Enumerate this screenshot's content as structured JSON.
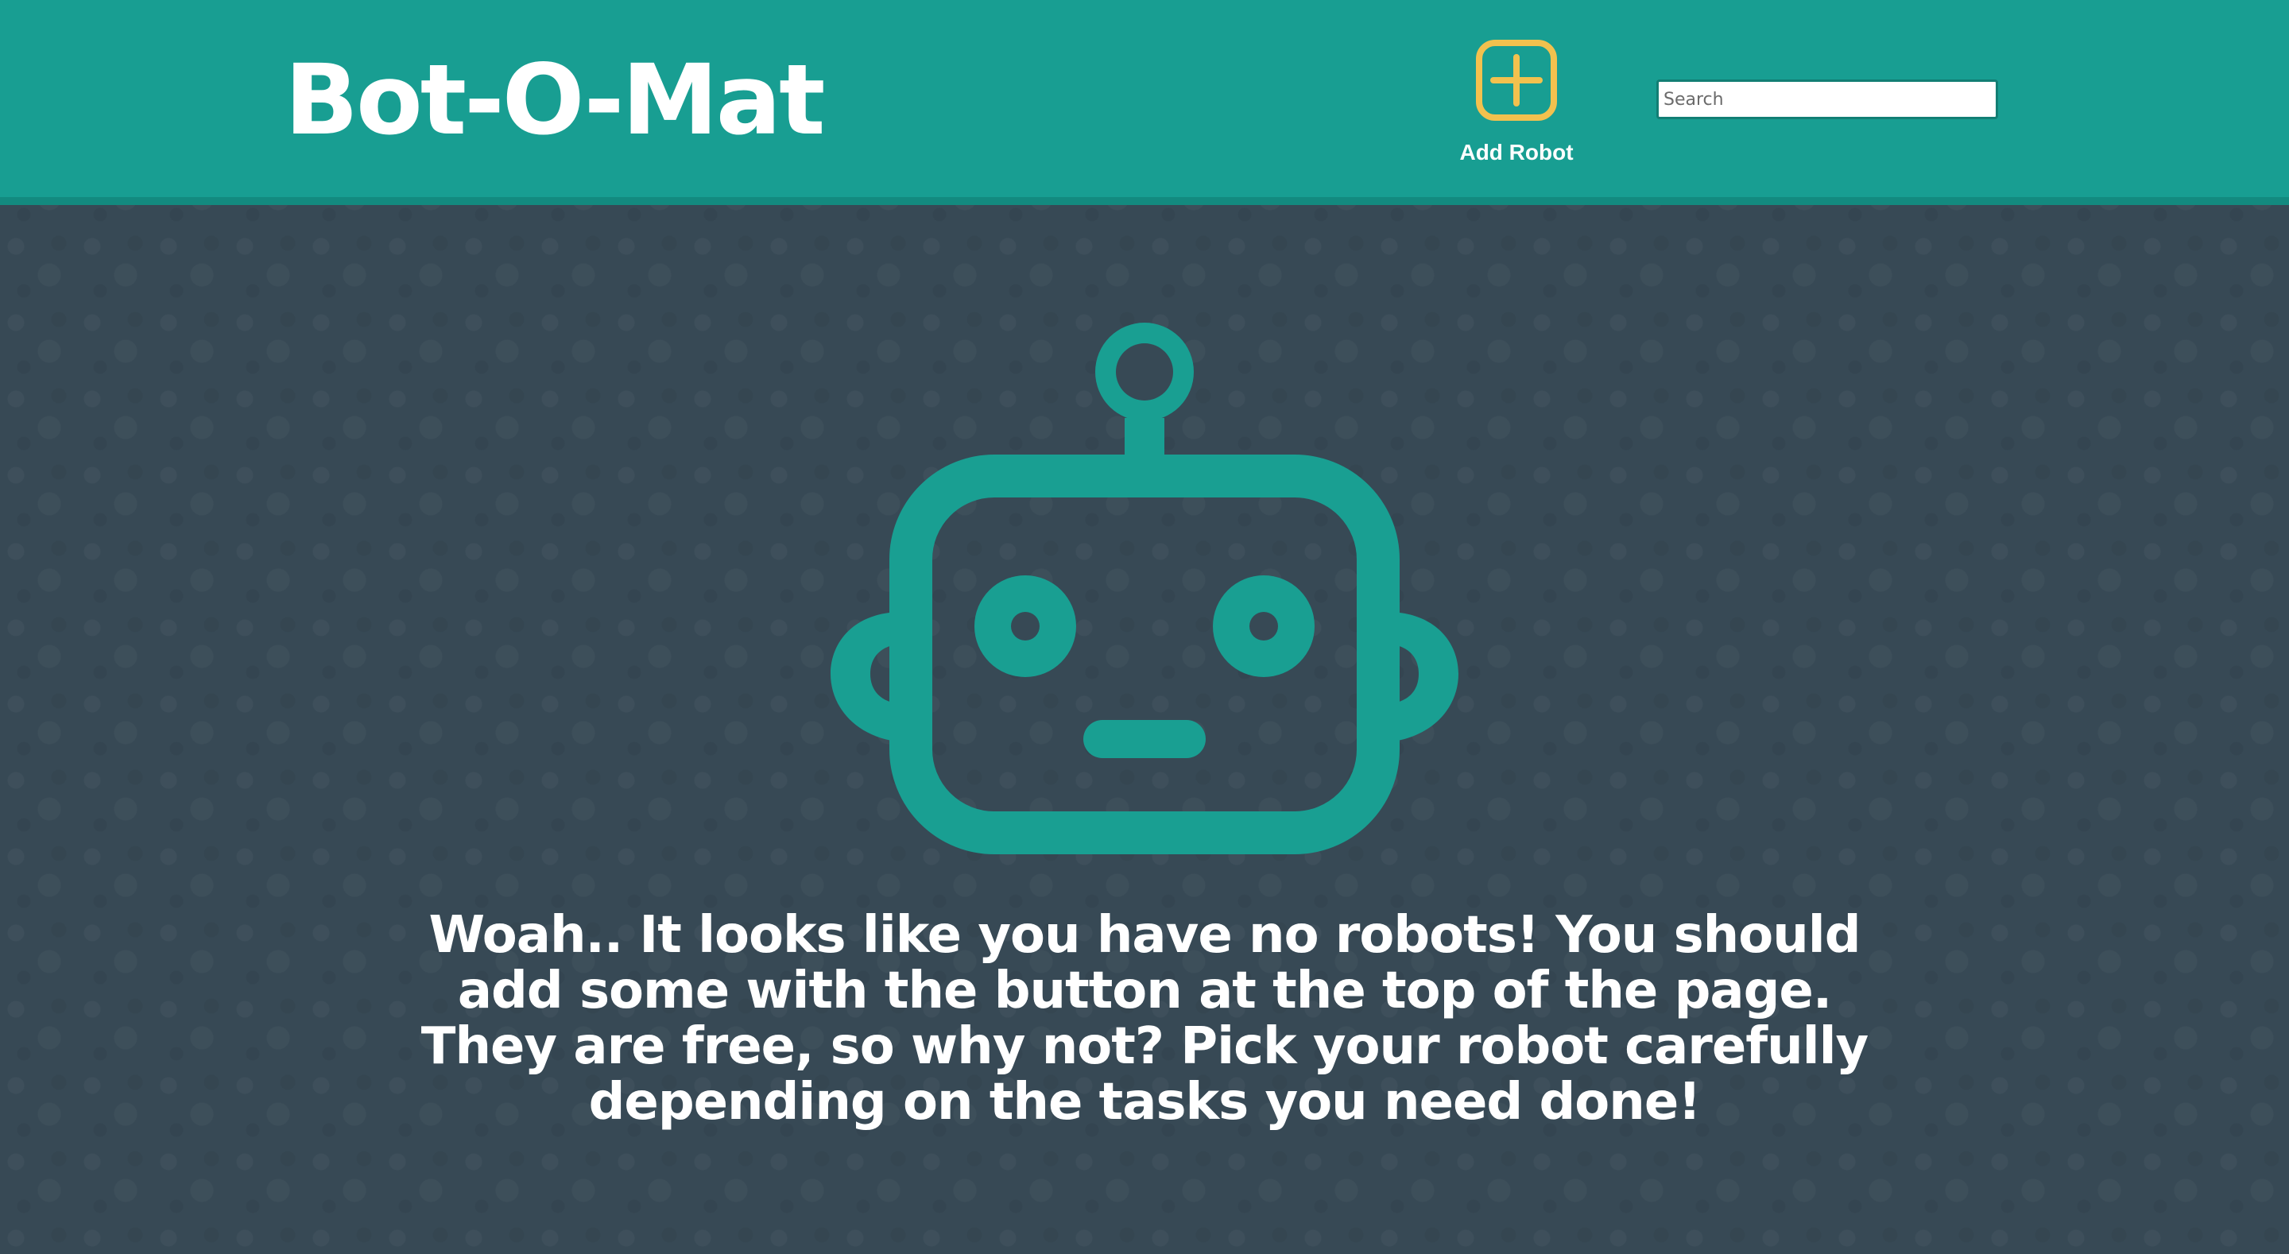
{
  "header": {
    "title": "Bot-O-Mat",
    "add_robot_label": "Add Robot",
    "search_placeholder": "Search",
    "search_value": ""
  },
  "main": {
    "empty_message": "Woah.. It looks like you have no robots! You should add some with the button at the top of the page. They are free, so why not? Pick your robot carefully depending on the tasks you need done!"
  },
  "icons": {
    "add": "add-square-icon",
    "illustration": "robot-face-icon"
  },
  "colors": {
    "header_bg": "#189e92",
    "page_bg": "#374955",
    "accent_yellow": "#f2c14e",
    "robot_teal": "#199f92",
    "text": "#ffffff"
  }
}
